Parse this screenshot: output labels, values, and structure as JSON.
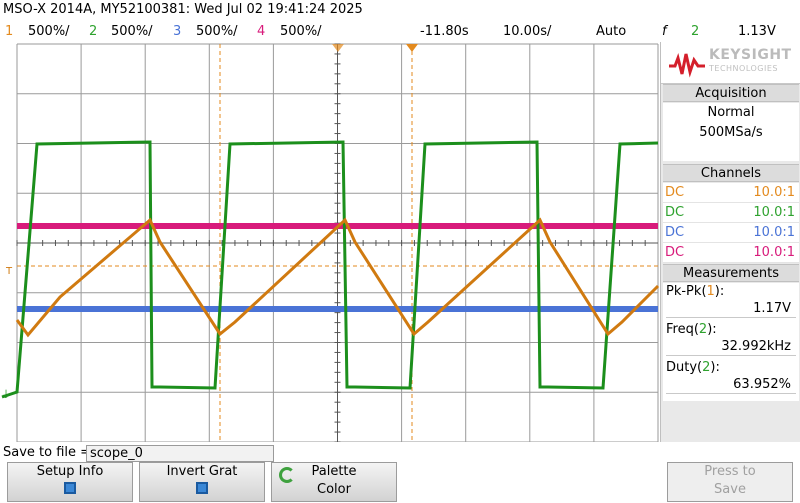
{
  "title": "MSO-X 2014A, MY52100381: Wed Jul 02 19:41:24 2025",
  "status": {
    "ch1_num": "1",
    "ch1_scale": "500%/",
    "ch2_num": "2",
    "ch2_scale": "500%/",
    "ch3_num": "3",
    "ch3_scale": "500%/",
    "ch4_num": "4",
    "ch4_scale": "500%/",
    "delay": "-11.80s",
    "timebase": "10.00s/",
    "mode": "Auto",
    "trig_symbol": "f",
    "trig_channel": "2",
    "trig_level": "1.13V"
  },
  "logo": {
    "brand": "KEYSIGHT",
    "sub": "TECHNOLOGIES"
  },
  "acquisition": {
    "header": "Acquisition",
    "mode": "Normal",
    "rate": "500MSa/s"
  },
  "channels": {
    "header": "Channels",
    "rows": [
      {
        "coupling": "DC",
        "probe": "10.0:1",
        "color": "#e38a1e"
      },
      {
        "coupling": "DC",
        "probe": "10.0:1",
        "color": "#2ea22e"
      },
      {
        "coupling": "DC",
        "probe": "10.0:1",
        "color": "#4a73d6"
      },
      {
        "coupling": "DC",
        "probe": "10.0:1",
        "color": "#d81b7b"
      }
    ]
  },
  "measurements": {
    "header": "Measurements",
    "pkpk_label": "Pk-Pk",
    "pkpk_ch": "1",
    "pkpk_value": "1.17V",
    "freq_label": "Freq",
    "freq_ch": "2",
    "freq_value": "32.992kHz",
    "duty_label": "Duty",
    "duty_ch": "2",
    "duty_value": "63.952%"
  },
  "save": {
    "label": "Save to file =",
    "filename": "scope_0"
  },
  "softkeys": {
    "setup_info": "Setup Info",
    "invert_grat": "Invert Grat",
    "palette_line1": "Palette",
    "palette_line2": "Color",
    "press_line1": "Press to",
    "press_line2": "Save"
  },
  "colors": {
    "ch1": "#d07a10",
    "ch2": "#1c8f1c",
    "ch3": "#4a73d6",
    "ch4": "#d81b7b",
    "trigger": "#e38a1e"
  }
}
